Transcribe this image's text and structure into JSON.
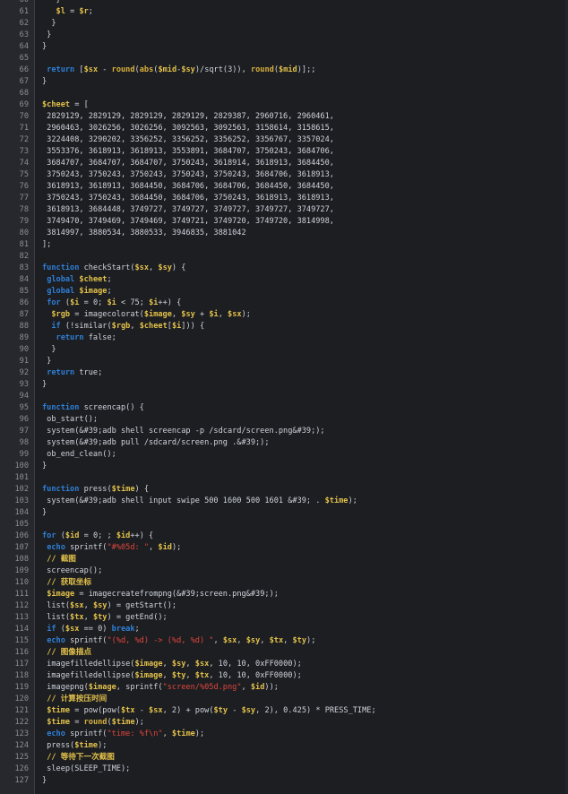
{
  "editor": {
    "colors": {
      "background": "#1c1e22",
      "keyword": "#2f7fd6",
      "variable": "#e2c04a",
      "string": "#e0463c",
      "text": "#cfd3da",
      "line_number": "#8a8e96"
    },
    "lines": [
      {
        "n": "60",
        "tokens": [
          [
            "tx",
            "   }"
          ]
        ]
      },
      {
        "n": "61",
        "tokens": [
          [
            "tx",
            "   "
          ],
          [
            "var",
            "$l"
          ],
          [
            "tx",
            " = "
          ],
          [
            "var",
            "$r"
          ],
          [
            "tx",
            ";"
          ]
        ]
      },
      {
        "n": "62",
        "tokens": [
          [
            "tx",
            "  }"
          ]
        ]
      },
      {
        "n": "63",
        "tokens": [
          [
            "tx",
            " }"
          ]
        ]
      },
      {
        "n": "64",
        "tokens": [
          [
            "tx",
            "}"
          ]
        ]
      },
      {
        "n": "65",
        "tokens": []
      },
      {
        "n": "66",
        "tokens": [
          [
            "tx",
            " "
          ],
          [
            "kw",
            "return"
          ],
          [
            "tx",
            " ["
          ],
          [
            "var",
            "$sx"
          ],
          [
            "tx",
            " - "
          ],
          [
            "fn",
            "round"
          ],
          [
            "tx",
            "("
          ],
          [
            "fn",
            "abs"
          ],
          [
            "tx",
            "("
          ],
          [
            "var",
            "$mid"
          ],
          [
            "tx",
            "-"
          ],
          [
            "var",
            "$sy"
          ],
          [
            "tx",
            ")/sqrt(3)), "
          ],
          [
            "fn",
            "round"
          ],
          [
            "tx",
            "("
          ],
          [
            "var",
            "$mid"
          ],
          [
            "tx",
            ")];;"
          ]
        ]
      },
      {
        "n": "67",
        "tokens": [
          [
            "tx",
            "}"
          ]
        ]
      },
      {
        "n": "68",
        "tokens": []
      },
      {
        "n": "69",
        "tokens": [
          [
            "var",
            "$cheet"
          ],
          [
            "tx",
            " = ["
          ]
        ]
      },
      {
        "n": "70",
        "tokens": [
          [
            "tx",
            " 2829129, 2829129, 2829129, 2829129, 2829387, 2960716, 2960461,"
          ]
        ]
      },
      {
        "n": "71",
        "tokens": [
          [
            "tx",
            " 2960463, 3026256, 3026256, 3092563, 3092563, 3158614, 3158615,"
          ]
        ]
      },
      {
        "n": "72",
        "tokens": [
          [
            "tx",
            " 3224408, 3290202, 3356252, 3356252, 3356252, 3356767, 3357024,"
          ]
        ]
      },
      {
        "n": "73",
        "tokens": [
          [
            "tx",
            " 3553376, 3618913, 3618913, 3553891, 3684707, 3750243, 3684706,"
          ]
        ]
      },
      {
        "n": "74",
        "tokens": [
          [
            "tx",
            " 3684707, 3684707, 3684707, 3750243, 3618914, 3618913, 3684450,"
          ]
        ]
      },
      {
        "n": "75",
        "tokens": [
          [
            "tx",
            " 3750243, 3750243, 3750243, 3750243, 3750243, 3684706, 3618913,"
          ]
        ]
      },
      {
        "n": "76",
        "tokens": [
          [
            "tx",
            " 3618913, 3618913, 3684450, 3684706, 3684706, 3684450, 3684450,"
          ]
        ]
      },
      {
        "n": "77",
        "tokens": [
          [
            "tx",
            " 3750243, 3750243, 3684450, 3684706, 3750243, 3618913, 3618913,"
          ]
        ]
      },
      {
        "n": "78",
        "tokens": [
          [
            "tx",
            " 3618913, 3684448, 3749727, 3749727, 3749727, 3749727, 3749727,"
          ]
        ]
      },
      {
        "n": "79",
        "tokens": [
          [
            "tx",
            " 3749470, 3749469, 3749469, 3749721, 3749720, 3749720, 3814998,"
          ]
        ]
      },
      {
        "n": "80",
        "tokens": [
          [
            "tx",
            " 3814997, 3880534, 3880533, 3946835, 3881042"
          ]
        ]
      },
      {
        "n": "81",
        "tokens": [
          [
            "tx",
            "];"
          ]
        ]
      },
      {
        "n": "82",
        "tokens": []
      },
      {
        "n": "83",
        "tokens": [
          [
            "kw",
            "function"
          ],
          [
            "tx",
            " checkStart("
          ],
          [
            "var",
            "$sx"
          ],
          [
            "tx",
            ", "
          ],
          [
            "var",
            "$sy"
          ],
          [
            "tx",
            ") {"
          ]
        ]
      },
      {
        "n": "84",
        "tokens": [
          [
            "tx",
            " "
          ],
          [
            "kw",
            "global"
          ],
          [
            "tx",
            " "
          ],
          [
            "var",
            "$cheet"
          ],
          [
            "tx",
            ";"
          ]
        ]
      },
      {
        "n": "85",
        "tokens": [
          [
            "tx",
            " "
          ],
          [
            "kw",
            "global"
          ],
          [
            "tx",
            " "
          ],
          [
            "var",
            "$image"
          ],
          [
            "tx",
            ";"
          ]
        ]
      },
      {
        "n": "86",
        "tokens": [
          [
            "tx",
            " "
          ],
          [
            "kw",
            "for"
          ],
          [
            "tx",
            " ("
          ],
          [
            "var",
            "$i"
          ],
          [
            "tx",
            " = 0; "
          ],
          [
            "var",
            "$i"
          ],
          [
            "tx",
            " < 75; "
          ],
          [
            "var",
            "$i"
          ],
          [
            "tx",
            "++) {"
          ]
        ]
      },
      {
        "n": "87",
        "tokens": [
          [
            "tx",
            "  "
          ],
          [
            "var",
            "$rgb"
          ],
          [
            "tx",
            " = imagecolorat("
          ],
          [
            "var",
            "$image"
          ],
          [
            "tx",
            ", "
          ],
          [
            "var",
            "$sy"
          ],
          [
            "tx",
            " + "
          ],
          [
            "var",
            "$i"
          ],
          [
            "tx",
            ", "
          ],
          [
            "var",
            "$sx"
          ],
          [
            "tx",
            ");"
          ]
        ]
      },
      {
        "n": "88",
        "tokens": [
          [
            "tx",
            "  "
          ],
          [
            "kw",
            "if"
          ],
          [
            "tx",
            " (!similar("
          ],
          [
            "var",
            "$rgb"
          ],
          [
            "tx",
            ", "
          ],
          [
            "var",
            "$cheet"
          ],
          [
            "tx",
            "["
          ],
          [
            "var",
            "$i"
          ],
          [
            "tx",
            "])) {"
          ]
        ]
      },
      {
        "n": "89",
        "tokens": [
          [
            "tx",
            "   "
          ],
          [
            "kw",
            "return"
          ],
          [
            "tx",
            " false;"
          ]
        ]
      },
      {
        "n": "90",
        "tokens": [
          [
            "tx",
            "  }"
          ]
        ]
      },
      {
        "n": "91",
        "tokens": [
          [
            "tx",
            " }"
          ]
        ]
      },
      {
        "n": "92",
        "tokens": [
          [
            "tx",
            " "
          ],
          [
            "kw",
            "return"
          ],
          [
            "tx",
            " true;"
          ]
        ]
      },
      {
        "n": "93",
        "tokens": [
          [
            "tx",
            "}"
          ]
        ]
      },
      {
        "n": "94",
        "tokens": []
      },
      {
        "n": "95",
        "tokens": [
          [
            "kw",
            "function"
          ],
          [
            "tx",
            " screencap() {"
          ]
        ]
      },
      {
        "n": "96",
        "tokens": [
          [
            "tx",
            " ob_start();"
          ]
        ]
      },
      {
        "n": "97",
        "tokens": [
          [
            "tx",
            " system(&#39;adb shell screencap -p /sdcard/screen.png&#39;);"
          ]
        ]
      },
      {
        "n": "98",
        "tokens": [
          [
            "tx",
            " system(&#39;adb pull /sdcard/screen.png .&#39;);"
          ]
        ]
      },
      {
        "n": "99",
        "tokens": [
          [
            "tx",
            " ob_end_clean();"
          ]
        ]
      },
      {
        "n": "100",
        "tokens": [
          [
            "tx",
            "}"
          ]
        ]
      },
      {
        "n": "101",
        "tokens": []
      },
      {
        "n": "102",
        "tokens": [
          [
            "kw",
            "function"
          ],
          [
            "tx",
            " press("
          ],
          [
            "var",
            "$time"
          ],
          [
            "tx",
            ") {"
          ]
        ]
      },
      {
        "n": "103",
        "tokens": [
          [
            "tx",
            " system(&#39;adb shell input swipe 500 1600 500 1601 &#39; . "
          ],
          [
            "var",
            "$time"
          ],
          [
            "tx",
            ");"
          ]
        ]
      },
      {
        "n": "104",
        "tokens": [
          [
            "tx",
            "}"
          ]
        ]
      },
      {
        "n": "105",
        "tokens": []
      },
      {
        "n": "106",
        "tokens": [
          [
            "kw",
            "for"
          ],
          [
            "tx",
            " ("
          ],
          [
            "var",
            "$id"
          ],
          [
            "tx",
            " = 0; ; "
          ],
          [
            "var",
            "$id"
          ],
          [
            "tx",
            "++) {"
          ]
        ]
      },
      {
        "n": "107",
        "tokens": [
          [
            "tx",
            " "
          ],
          [
            "kw",
            "echo"
          ],
          [
            "tx",
            " sprintf("
          ],
          [
            "str",
            "\"#%05d: \""
          ],
          [
            "tx",
            ", "
          ],
          [
            "var",
            "$id"
          ],
          [
            "tx",
            ");"
          ]
        ]
      },
      {
        "n": "108",
        "tokens": [
          [
            "tx",
            " "
          ],
          [
            "cm",
            "// 截图"
          ]
        ]
      },
      {
        "n": "109",
        "tokens": [
          [
            "tx",
            " screencap();"
          ]
        ]
      },
      {
        "n": "110",
        "tokens": [
          [
            "tx",
            " "
          ],
          [
            "cm",
            "// 获取坐标"
          ]
        ]
      },
      {
        "n": "111",
        "tokens": [
          [
            "tx",
            " "
          ],
          [
            "var",
            "$image"
          ],
          [
            "tx",
            " = imagecreatefrompng(&#39;screen.png&#39;);"
          ]
        ]
      },
      {
        "n": "112",
        "tokens": [
          [
            "tx",
            " list("
          ],
          [
            "var",
            "$sx"
          ],
          [
            "tx",
            ", "
          ],
          [
            "var",
            "$sy"
          ],
          [
            "tx",
            ") = getStart();"
          ]
        ]
      },
      {
        "n": "113",
        "tokens": [
          [
            "tx",
            " list("
          ],
          [
            "var",
            "$tx"
          ],
          [
            "tx",
            ", "
          ],
          [
            "var",
            "$ty"
          ],
          [
            "tx",
            ") = getEnd();"
          ]
        ]
      },
      {
        "n": "114",
        "tokens": [
          [
            "tx",
            " "
          ],
          [
            "kw",
            "if"
          ],
          [
            "tx",
            " ("
          ],
          [
            "var",
            "$sx"
          ],
          [
            "tx",
            " == 0) "
          ],
          [
            "kw",
            "break"
          ],
          [
            "tx",
            ";"
          ]
        ]
      },
      {
        "n": "115",
        "tokens": [
          [
            "tx",
            " "
          ],
          [
            "kw",
            "echo"
          ],
          [
            "tx",
            " sprintf("
          ],
          [
            "str",
            "\"(%d, %d) -> (%d, %d) \""
          ],
          [
            "tx",
            ", "
          ],
          [
            "var",
            "$sx"
          ],
          [
            "tx",
            ", "
          ],
          [
            "var",
            "$sy"
          ],
          [
            "tx",
            ", "
          ],
          [
            "var",
            "$tx"
          ],
          [
            "tx",
            ", "
          ],
          [
            "var",
            "$ty"
          ],
          [
            "tx",
            ");"
          ]
        ]
      },
      {
        "n": "116",
        "tokens": [
          [
            "tx",
            " "
          ],
          [
            "cm",
            "// 图像描点"
          ]
        ]
      },
      {
        "n": "117",
        "tokens": [
          [
            "tx",
            " imagefilledellipse("
          ],
          [
            "var",
            "$image"
          ],
          [
            "tx",
            ", "
          ],
          [
            "var",
            "$sy"
          ],
          [
            "tx",
            ", "
          ],
          [
            "var",
            "$sx"
          ],
          [
            "tx",
            ", 10, 10, 0xFF0000);"
          ]
        ]
      },
      {
        "n": "118",
        "tokens": [
          [
            "tx",
            " imagefilledellipse("
          ],
          [
            "var",
            "$image"
          ],
          [
            "tx",
            ", "
          ],
          [
            "var",
            "$ty"
          ],
          [
            "tx",
            ", "
          ],
          [
            "var",
            "$tx"
          ],
          [
            "tx",
            ", 10, 10, 0xFF0000);"
          ]
        ]
      },
      {
        "n": "119",
        "tokens": [
          [
            "tx",
            " imagepng("
          ],
          [
            "var",
            "$image"
          ],
          [
            "tx",
            ", sprintf("
          ],
          [
            "str",
            "\"screen/%05d.png\""
          ],
          [
            "tx",
            ", "
          ],
          [
            "var",
            "$id"
          ],
          [
            "tx",
            "));"
          ]
        ]
      },
      {
        "n": "120",
        "tokens": [
          [
            "tx",
            " "
          ],
          [
            "cm",
            "// 计算按压时间"
          ]
        ]
      },
      {
        "n": "121",
        "tokens": [
          [
            "tx",
            " "
          ],
          [
            "var",
            "$time"
          ],
          [
            "tx",
            " = pow(pow("
          ],
          [
            "var",
            "$tx"
          ],
          [
            "tx",
            " - "
          ],
          [
            "var",
            "$sx"
          ],
          [
            "tx",
            ", 2) + pow("
          ],
          [
            "var",
            "$ty"
          ],
          [
            "tx",
            " - "
          ],
          [
            "var",
            "$sy"
          ],
          [
            "tx",
            ", 2), 0.425) * PRESS_TIME;"
          ]
        ]
      },
      {
        "n": "122",
        "tokens": [
          [
            "tx",
            " "
          ],
          [
            "var",
            "$time"
          ],
          [
            "tx",
            " = "
          ],
          [
            "fn",
            "round"
          ],
          [
            "tx",
            "("
          ],
          [
            "var",
            "$time"
          ],
          [
            "tx",
            ");"
          ]
        ]
      },
      {
        "n": "123",
        "tokens": [
          [
            "tx",
            " "
          ],
          [
            "kw",
            "echo"
          ],
          [
            "tx",
            " sprintf("
          ],
          [
            "str",
            "\"time: %f\\n\""
          ],
          [
            "tx",
            ", "
          ],
          [
            "var",
            "$time"
          ],
          [
            "tx",
            ");"
          ]
        ]
      },
      {
        "n": "124",
        "tokens": [
          [
            "tx",
            " press("
          ],
          [
            "var",
            "$time"
          ],
          [
            "tx",
            ");"
          ]
        ]
      },
      {
        "n": "125",
        "tokens": [
          [
            "tx",
            " "
          ],
          [
            "cm",
            "// 等待下一次截图"
          ]
        ]
      },
      {
        "n": "126",
        "tokens": [
          [
            "tx",
            " sleep(SLEEP_TIME);"
          ]
        ]
      },
      {
        "n": "127",
        "tokens": [
          [
            "tx",
            "}"
          ]
        ]
      }
    ]
  }
}
